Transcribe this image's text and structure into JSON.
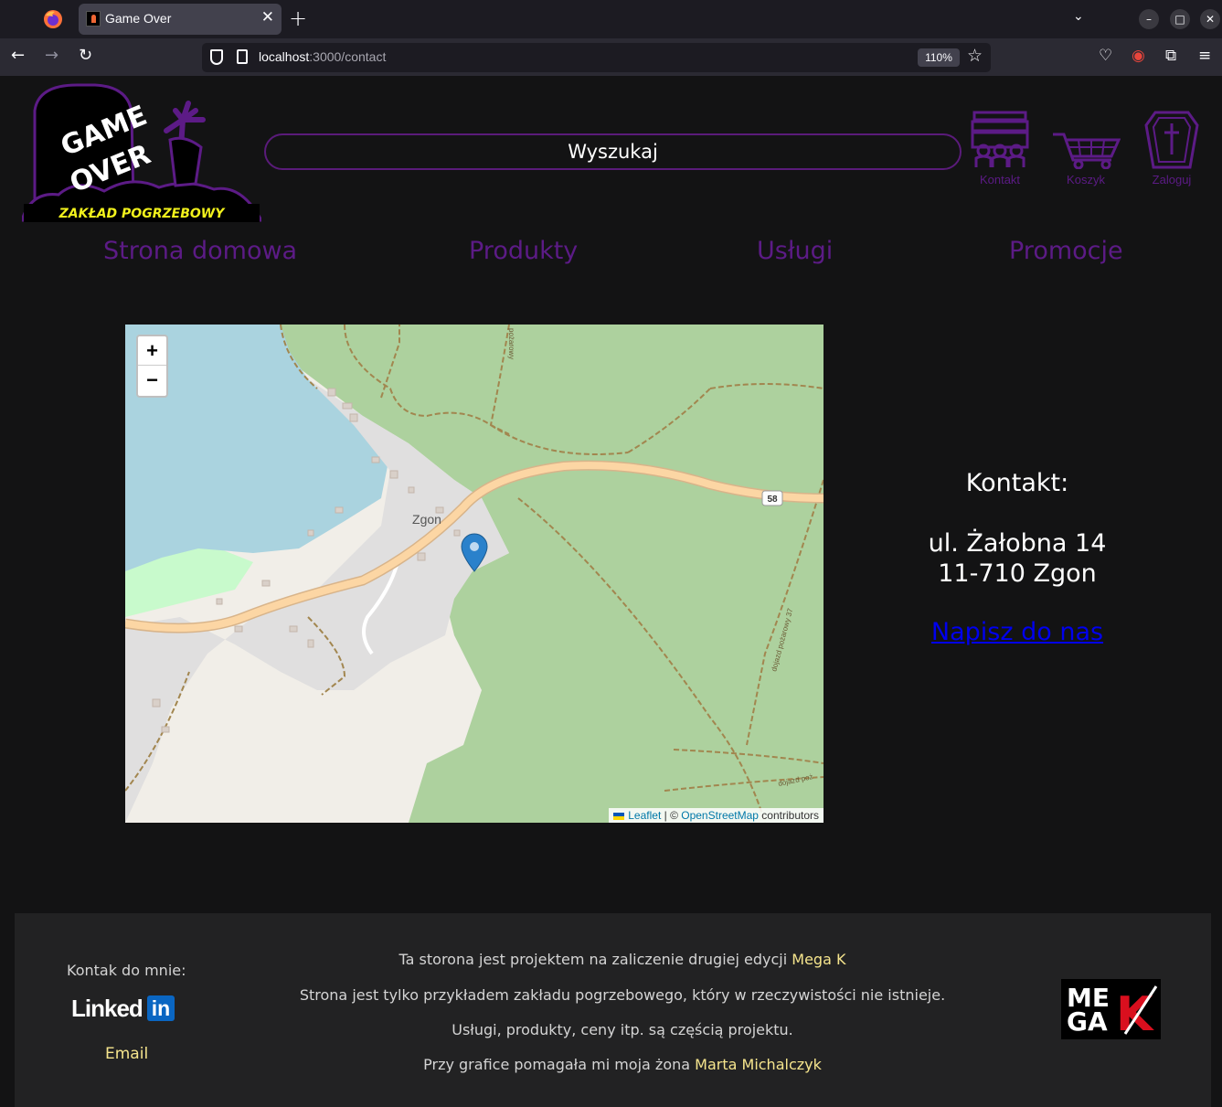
{
  "browser": {
    "tab_title": "Game Over",
    "url_host": "localhost",
    "url_path": ":3000/contact",
    "zoom": "110%"
  },
  "header": {
    "logo_game": "GAME",
    "logo_over": "OVER",
    "logo_subtitle": "ZAKŁAD POGRZEBOWY",
    "search_placeholder": "Wyszukaj",
    "items": [
      {
        "label": "Kontakt",
        "icon": "hearse-icon"
      },
      {
        "label": "Koszyk",
        "icon": "cart-icon"
      },
      {
        "label": "Zaloguj",
        "icon": "coffin-icon"
      }
    ]
  },
  "menu": [
    "Strona domowa",
    "Produkty",
    "Usługi",
    "Promocje"
  ],
  "map": {
    "zoom_in": "+",
    "zoom_out": "−",
    "place_label": "Zgon",
    "road_number": "58",
    "road_label_1": "dojazd pożarowy 37",
    "road_label_2": "dojazd poż",
    "road_label_3": "pożarowy",
    "attribution_leaflet": "Leaflet",
    "attribution_sep": " | © ",
    "attribution_osm": "OpenStreetMap",
    "attribution_tail": " contributors"
  },
  "contact": {
    "title": "Kontakt:",
    "street": "ul. Żałobna 14",
    "city": "11-710 Zgon",
    "link": "Napisz do nas"
  },
  "footer": {
    "contact_label": "Kontak do mnie:",
    "linkedin_word": "Linked",
    "linkedin_box": "in",
    "email": "Email",
    "line1_text": "Ta storona jest projektem na zaliczenie drugiej edycji ",
    "line1_highlight": "Mega K",
    "line2": "Strona jest tylko przykładem zakładu pogrzebowego, który w rzeczywistości nie istnieje.",
    "line3": "Usługi, produkty, ceny itp. są częścią projektu.",
    "line4_text": "Przy grafice pomagała mi moja żona ",
    "line4_highlight": "Marta Michalczyk",
    "megak_top": "ME",
    "megak_bottom": "GA",
    "megak_k": "K"
  },
  "colors": {
    "accent_purple": "#5c1b86",
    "highlight_yellow": "#f6e58d",
    "link_blue": "#0000ee"
  }
}
